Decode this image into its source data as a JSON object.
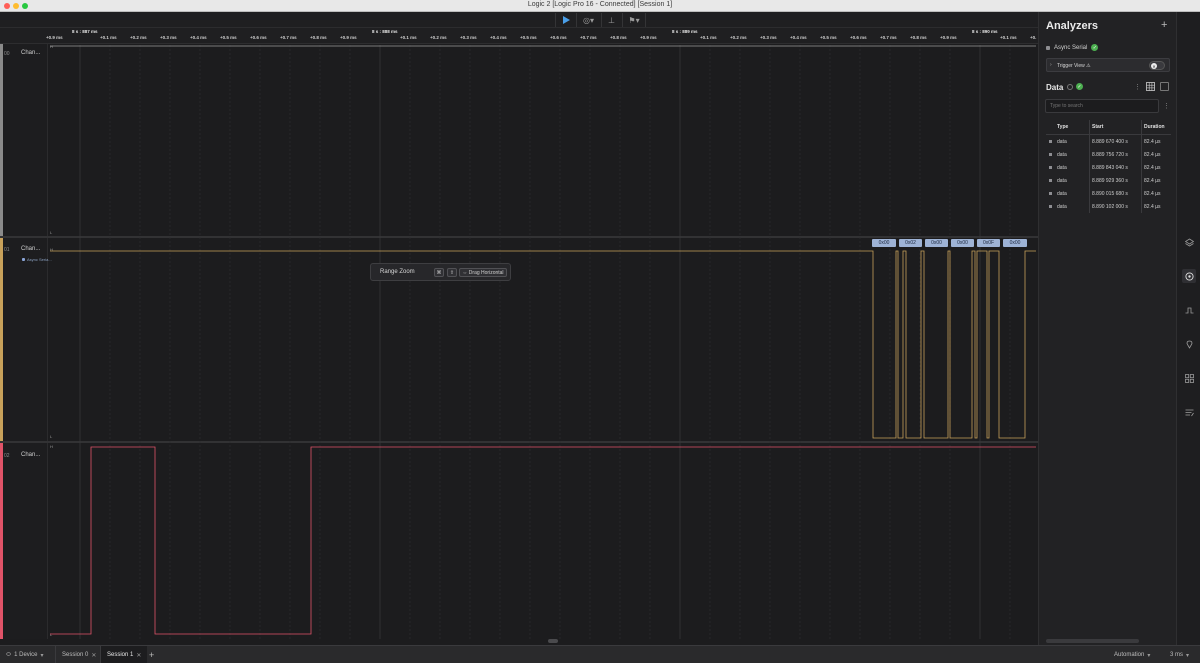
{
  "window": {
    "title": "Logic 2 [Logic Pro 16 - Connected] [Session 1]"
  },
  "toolbar": {
    "play_icon": "play-icon",
    "trigger_icon": "trigger-icon",
    "sample_icon": "sample-icon",
    "measure_icon": "measure-icon"
  },
  "ruler": {
    "major": [
      {
        "label": "8 s : 887 ms"
      },
      {
        "label": "8 s : 888 ms"
      },
      {
        "label": "8 s : 889 ms"
      },
      {
        "label": "8 s : 890 ms"
      }
    ],
    "leading_tick": "+0.9 ms",
    "ticks": [
      "+0.1 ms",
      "+0.2 ms",
      "+0.3 ms",
      "+0.4 ms",
      "+0.5 ms",
      "+0.6 ms",
      "+0.7 ms",
      "+0.8 ms",
      "+0.9 ms"
    ],
    "trailing": [
      "+0.1 ms",
      "+0."
    ]
  },
  "channels": [
    {
      "num": "00",
      "name": "Chan...",
      "color": "#8a8a8a",
      "high": "H",
      "low": "L"
    },
    {
      "num": "01",
      "name": "Chan...",
      "color": "#c8a15a",
      "high": "H",
      "low": "L",
      "analyzer": "Async Seria..."
    },
    {
      "num": "02",
      "name": "Chan...",
      "color": "#e05368",
      "high": "H",
      "low": "L"
    }
  ],
  "decoded": [
    "0x00",
    "0x02",
    "0x00",
    "0x00",
    "0x0F",
    "0x00"
  ],
  "tooltip": {
    "title": "Range Zoom",
    "key1": "⌘",
    "key2": "⇧",
    "key3": "⇔ Drag Horizontal"
  },
  "right_panel": {
    "title": "Analyzers",
    "add": "+",
    "analyzer_name": "Async Serial",
    "trigger_view": "Trigger View ⚠",
    "data_title": "Data",
    "search_placeholder": "Type to search",
    "table": {
      "headers": [
        "Type",
        "Start",
        "Duration"
      ],
      "rows": [
        {
          "type": "data",
          "start": "8.889 670 400 s",
          "duration": "82.4 µs"
        },
        {
          "type": "data",
          "start": "8.889 756 720 s",
          "duration": "82.4 µs"
        },
        {
          "type": "data",
          "start": "8.889 843 040 s",
          "duration": "82.4 µs"
        },
        {
          "type": "data",
          "start": "8.889 929 360 s",
          "duration": "82.4 µs"
        },
        {
          "type": "data",
          "start": "8.890 015 680 s",
          "duration": "82.4 µs"
        },
        {
          "type": "data",
          "start": "8.890 102 000 s",
          "duration": "82.4 µs"
        }
      ]
    }
  },
  "bottom": {
    "device": "1 Device",
    "tabs": [
      {
        "label": "Session 0",
        "active": false
      },
      {
        "label": "Session 1",
        "active": true
      }
    ],
    "add": "+",
    "automation": "Automation",
    "timescale": "3 ms"
  },
  "colors": {
    "accent_play": "#4a9fe8",
    "ch1_trace": "#c8a15a",
    "ch2_trace": "#e05368",
    "ok_green": "#4caf50"
  }
}
